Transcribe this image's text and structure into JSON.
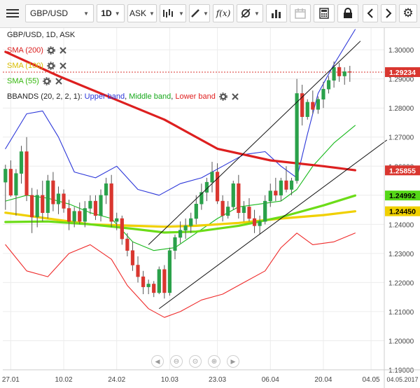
{
  "toolbar": {
    "symbol": "GBP/USD",
    "timeframe": "1D",
    "price_side": "ASK",
    "icons": [
      "menu-icon",
      "chart-type-icon",
      "draw-icon",
      "function-icon",
      "indicator-icon",
      "bar-chart-icon",
      "calendar-icon",
      "calculator-icon",
      "lock-icon",
      "back-icon",
      "forward-icon",
      "gear-icon"
    ]
  },
  "chart_title": "GBP/USD, 1D, ASK",
  "legend": {
    "sma200": "SMA (200)",
    "sma100": "SMA (100)",
    "sma55": "SMA (55)",
    "bbands_prefix": "BBANDS (20, 2, 2, 1): ",
    "upper": "Upper band",
    "middle": "Middle band",
    "lower": "Lower band"
  },
  "colors": {
    "up_candle": "#2aa14a",
    "down_candle": "#d9362f",
    "sma200": "#dd1f1f",
    "sma100": "#f0d000",
    "sma55": "#6cdc18",
    "upper": "#2b36d9",
    "middle": "#17b91b",
    "lower": "#ef2a2a",
    "current_price": "#d9362f"
  },
  "price_tags": [
    {
      "value": "1.29234",
      "price": 1.29234,
      "color": "#d9362f",
      "text_color": "#ffffff"
    },
    {
      "value": "1.25855",
      "price": 1.25855,
      "color": "#d9362f",
      "text_color": "#ffffff"
    },
    {
      "value": "1.24992",
      "price": 1.24992,
      "color": "#55d818",
      "text_color": "#000000"
    },
    {
      "value": "1.24450",
      "price": 1.2445,
      "color": "#f0d000",
      "text_color": "#000000"
    }
  ],
  "chart_data": {
    "type": "line",
    "ylim": [
      1.19,
      1.3075
    ],
    "y_ticks": [
      1.19,
      1.2,
      1.21,
      1.22,
      1.23,
      1.24,
      1.25,
      1.26,
      1.27,
      1.28,
      1.29,
      1.3
    ],
    "y_tick_labels": [
      "1.19000",
      "1.20000",
      "1.21000",
      "1.22000",
      "1.23000",
      "1.24000",
      "1.25000",
      "1.26000",
      "1.27000",
      "1.28000",
      "1.29000",
      "1.30000"
    ],
    "x_tick_labels": [
      {
        "label": "27.01",
        "index": 1
      },
      {
        "label": "10.02",
        "index": 11
      },
      {
        "label": "24.02",
        "index": 21
      },
      {
        "label": "10.03",
        "index": 31
      },
      {
        "label": "23.03",
        "index": 40
      },
      {
        "label": "04.05",
        "index": 69
      }
    ],
    "x_tick_labels_extra": [
      {
        "label": "06.04",
        "index": 50
      },
      {
        "label": "20.04",
        "index": 60
      }
    ],
    "axis_corner_label": "04.05.2017",
    "current_price": 1.29234,
    "candles": [
      [
        1.2545,
        1.2605,
        1.245,
        1.259
      ],
      [
        1.259,
        1.262,
        1.2495,
        1.25
      ],
      [
        1.25,
        1.259,
        1.243,
        1.2575
      ],
      [
        1.2575,
        1.267,
        1.254,
        1.265
      ],
      [
        1.265,
        1.27,
        1.248,
        1.25
      ],
      [
        1.25,
        1.2525,
        1.237,
        1.2425
      ],
      [
        1.2425,
        1.252,
        1.239,
        1.25
      ],
      [
        1.25,
        1.255,
        1.241,
        1.244
      ],
      [
        1.244,
        1.257,
        1.242,
        1.255
      ],
      [
        1.255,
        1.258,
        1.2445,
        1.247
      ],
      [
        1.247,
        1.253,
        1.2435,
        1.2505
      ],
      [
        1.2505,
        1.252,
        1.244,
        1.2455
      ],
      [
        1.2455,
        1.2485,
        1.238,
        1.241
      ],
      [
        1.241,
        1.246,
        1.239,
        1.2445
      ],
      [
        1.2445,
        1.2475,
        1.24,
        1.241
      ],
      [
        1.241,
        1.248,
        1.239,
        1.2455
      ],
      [
        1.2455,
        1.25,
        1.2435,
        1.248
      ],
      [
        1.248,
        1.25,
        1.2415,
        1.243
      ],
      [
        1.243,
        1.252,
        1.241,
        1.25
      ],
      [
        1.25,
        1.256,
        1.247,
        1.254
      ],
      [
        1.254,
        1.257,
        1.239,
        1.241
      ],
      [
        1.241,
        1.244,
        1.238,
        1.242
      ],
      [
        1.242,
        1.243,
        1.233,
        1.235
      ],
      [
        1.235,
        1.237,
        1.229,
        1.231
      ],
      [
        1.231,
        1.234,
        1.224,
        1.226
      ],
      [
        1.226,
        1.229,
        1.22,
        1.222
      ],
      [
        1.222,
        1.224,
        1.216,
        1.2185
      ],
      [
        1.2185,
        1.221,
        1.216,
        1.2195
      ],
      [
        1.2195,
        1.2205,
        1.215,
        1.2165
      ],
      [
        1.2165,
        1.2255,
        1.216,
        1.2245
      ],
      [
        1.2245,
        1.226,
        1.2145,
        1.2165
      ],
      [
        1.2165,
        1.232,
        1.2155,
        1.231
      ],
      [
        1.231,
        1.2365,
        1.228,
        1.2355
      ],
      [
        1.2355,
        1.241,
        1.2335,
        1.238
      ],
      [
        1.238,
        1.242,
        1.235,
        1.2395
      ],
      [
        1.2395,
        1.244,
        1.237,
        1.242
      ],
      [
        1.242,
        1.25,
        1.24,
        1.247
      ],
      [
        1.247,
        1.254,
        1.245,
        1.251
      ],
      [
        1.251,
        1.256,
        1.248,
        1.2545
      ],
      [
        1.2545,
        1.2615,
        1.251,
        1.258
      ],
      [
        1.258,
        1.261,
        1.247,
        1.248
      ],
      [
        1.248,
        1.25,
        1.241,
        1.243
      ],
      [
        1.243,
        1.248,
        1.242,
        1.246
      ],
      [
        1.246,
        1.255,
        1.245,
        1.254
      ],
      [
        1.254,
        1.257,
        1.242,
        1.244
      ],
      [
        1.244,
        1.248,
        1.241,
        1.246
      ],
      [
        1.246,
        1.249,
        1.241,
        1.242
      ],
      [
        1.242,
        1.245,
        1.237,
        1.2395
      ],
      [
        1.2395,
        1.243,
        1.2365,
        1.241
      ],
      [
        1.241,
        1.25,
        1.24,
        1.248
      ],
      [
        1.248,
        1.254,
        1.246,
        1.2515
      ],
      [
        1.2515,
        1.256,
        1.248,
        1.25
      ],
      [
        1.25,
        1.256,
        1.248,
        1.255
      ],
      [
        1.255,
        1.26,
        1.251,
        1.252
      ],
      [
        1.252,
        1.256,
        1.25,
        1.255
      ],
      [
        1.255,
        1.29,
        1.254,
        1.285
      ],
      [
        1.285,
        1.288,
        1.274,
        1.277
      ],
      [
        1.277,
        1.283,
        1.276,
        1.282
      ],
      [
        1.282,
        1.286,
        1.278,
        1.2795
      ],
      [
        1.2795,
        1.284,
        1.278,
        1.283
      ],
      [
        1.283,
        1.289,
        1.28,
        1.2865
      ],
      [
        1.2865,
        1.291,
        1.285,
        1.2895
      ],
      [
        1.2895,
        1.296,
        1.287,
        1.294
      ],
      [
        1.294,
        1.2955,
        1.289,
        1.291
      ],
      [
        1.291,
        1.294,
        1.288,
        1.2925
      ],
      [
        1.2925,
        1.2945,
        1.289,
        1.2923
      ]
    ],
    "series": [
      {
        "name": "SMA (200)",
        "points": [
          [
            0,
            1.2993
          ],
          [
            10,
            1.291
          ],
          [
            20,
            1.2835
          ],
          [
            30,
            1.276
          ],
          [
            40,
            1.266
          ],
          [
            50,
            1.262
          ],
          [
            60,
            1.26
          ],
          [
            66,
            1.2586
          ]
        ]
      },
      {
        "name": "SMA (100)",
        "points": [
          [
            0,
            1.244
          ],
          [
            8,
            1.242
          ],
          [
            16,
            1.24
          ],
          [
            24,
            1.2395
          ],
          [
            30,
            1.2392
          ],
          [
            36,
            1.2395
          ],
          [
            44,
            1.2405
          ],
          [
            52,
            1.242
          ],
          [
            60,
            1.2432
          ],
          [
            66,
            1.2445
          ]
        ]
      },
      {
        "name": "SMA (55)",
        "points": [
          [
            0,
            1.2408
          ],
          [
            8,
            1.241
          ],
          [
            16,
            1.24
          ],
          [
            24,
            1.2385
          ],
          [
            30,
            1.2372
          ],
          [
            36,
            1.2375
          ],
          [
            44,
            1.2395
          ],
          [
            52,
            1.2425
          ],
          [
            60,
            1.2465
          ],
          [
            66,
            1.2499
          ]
        ]
      },
      {
        "name": "Upper band",
        "points": [
          [
            0,
            1.266
          ],
          [
            4,
            1.278
          ],
          [
            7,
            1.279
          ],
          [
            10,
            1.27
          ],
          [
            13,
            1.258
          ],
          [
            17,
            1.256
          ],
          [
            21,
            1.26
          ],
          [
            25,
            1.252
          ],
          [
            29,
            1.25
          ],
          [
            33,
            1.254
          ],
          [
            37,
            1.256
          ],
          [
            41,
            1.26
          ],
          [
            45,
            1.264
          ],
          [
            49,
            1.265
          ],
          [
            52,
            1.26
          ],
          [
            55,
            1.256
          ],
          [
            57,
            1.271
          ],
          [
            59,
            1.285
          ],
          [
            62,
            1.295
          ],
          [
            66,
            1.307
          ]
        ]
      },
      {
        "name": "Middle band",
        "points": [
          [
            0,
            1.248
          ],
          [
            4,
            1.25
          ],
          [
            8,
            1.249
          ],
          [
            12,
            1.247
          ],
          [
            16,
            1.244
          ],
          [
            20,
            1.242
          ],
          [
            24,
            1.234
          ],
          [
            28,
            1.231
          ],
          [
            32,
            1.232
          ],
          [
            36,
            1.237
          ],
          [
            40,
            1.242
          ],
          [
            44,
            1.246
          ],
          [
            48,
            1.247
          ],
          [
            52,
            1.248
          ],
          [
            55,
            1.252
          ],
          [
            58,
            1.26
          ],
          [
            62,
            1.268
          ],
          [
            66,
            1.274
          ]
        ]
      },
      {
        "name": "Lower band",
        "points": [
          [
            0,
            1.233
          ],
          [
            4,
            1.224
          ],
          [
            8,
            1.222
          ],
          [
            12,
            1.23
          ],
          [
            16,
            1.233
          ],
          [
            20,
            1.228
          ],
          [
            23,
            1.219
          ],
          [
            27,
            1.211
          ],
          [
            30,
            1.208
          ],
          [
            33,
            1.21
          ],
          [
            37,
            1.214
          ],
          [
            41,
            1.216
          ],
          [
            45,
            1.22
          ],
          [
            49,
            1.224
          ],
          [
            52,
            1.232
          ],
          [
            55,
            1.237
          ],
          [
            58,
            1.233
          ],
          [
            62,
            1.234
          ],
          [
            66,
            1.237
          ]
        ]
      }
    ],
    "trendlines": [
      {
        "name": "channel-upper",
        "points": [
          [
            27,
            1.233
          ],
          [
            67,
            1.303
          ]
        ]
      },
      {
        "name": "channel-lower",
        "points": [
          [
            29,
            1.211
          ],
          [
            72,
            1.269
          ]
        ]
      }
    ]
  }
}
